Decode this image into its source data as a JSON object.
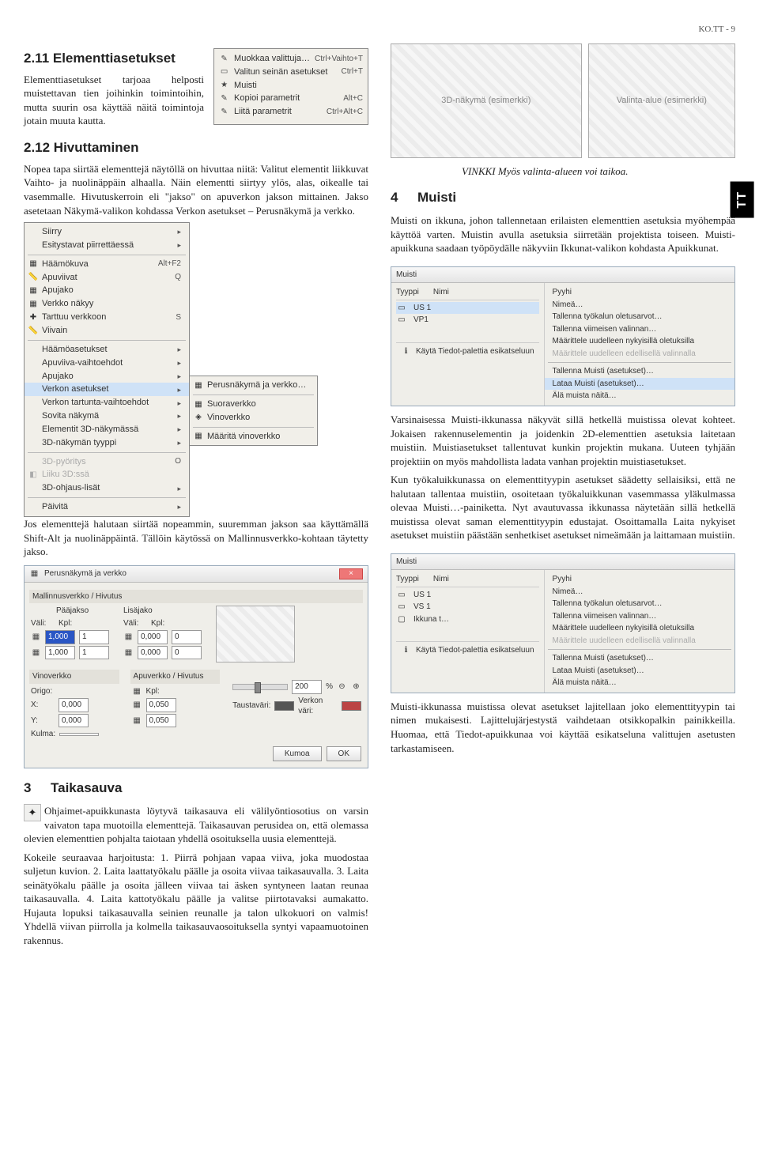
{
  "page_header": "KO.TT - 9",
  "side_tab": "TT",
  "sec211": {
    "title": "2.11  Elementtiasetukset",
    "p1": "Elementtiasetukset tarjoaa helposti muistettavan tien joihinkin toimintoihin, mutta suurin osa käyttää näitä toimintoja jotain muuta kautta."
  },
  "ctxmenu": {
    "items": [
      {
        "icon": "✎",
        "label": "Muokkaa valittuja…",
        "short": "Ctrl+Vaihto+T"
      },
      {
        "icon": "▭",
        "label": "Valitun seinän asetukset",
        "short": "Ctrl+T"
      },
      {
        "icon": "★",
        "label": "Muisti",
        "short": ""
      },
      {
        "icon": "✎",
        "label": "Kopioi parametrit",
        "short": "Alt+C"
      },
      {
        "icon": "✎",
        "label": "Liitä parametrit",
        "short": "Ctrl+Alt+C"
      }
    ]
  },
  "sec212": {
    "title": "2.12  Hivuttaminen",
    "p1": "Nopea tapa siirtää elementtejä näytöllä on hivuttaa niitä: Valitut elementit liikkuvat Vaihto- ja nuolinäppäin alhaalla. Näin elementti siirtyy ylös, alas, oikealle tai vasemmalle. Hivutuskerroin eli \"jakso\" on apuverkon jakson mittainen. Jakso asetetaan Näkymä-valikon kohdassa Verkon asetukset – Perusnäkymä ja verkko."
  },
  "viewmenu": {
    "left": [
      {
        "label": "Siirry",
        "arrow": true
      },
      {
        "label": "Esitystavat piirrettäessä",
        "arrow": true
      },
      {
        "sep": true
      },
      {
        "icon": "▦",
        "label": "Häämökuva",
        "short": "Alt+F2"
      },
      {
        "icon": "📏",
        "label": "Apuviivat",
        "short": "Q"
      },
      {
        "icon": "▦",
        "label": "Apujako"
      },
      {
        "icon": "▦",
        "label": "Verkko näkyy"
      },
      {
        "icon": "✚",
        "label": "Tarttuu verkkoon",
        "short": "S"
      },
      {
        "icon": "📏",
        "label": "Viivain"
      },
      {
        "sep": true
      },
      {
        "label": "Häämöasetukset",
        "arrow": true
      },
      {
        "label": "Apuviiva-vaihtoehdot",
        "arrow": true
      },
      {
        "label": "Apujako",
        "arrow": true
      },
      {
        "label": "Verkon asetukset",
        "arrow": true,
        "high": true
      },
      {
        "label": "Verkon tartunta-vaihtoehdot",
        "arrow": true
      },
      {
        "label": "Sovita näkymä",
        "arrow": true
      },
      {
        "label": "Elementit 3D-näkymässä",
        "arrow": true
      },
      {
        "label": "3D-näkymän tyyppi",
        "arrow": true
      },
      {
        "sep": true
      },
      {
        "label": "3D-pyöritys",
        "short": "O",
        "dis": true
      },
      {
        "icon": "◧",
        "label": "Liiku 3D:ssä",
        "dis": true
      },
      {
        "label": "3D-ohjaus-lisät",
        "arrow": true
      },
      {
        "sep": true
      },
      {
        "label": "Päivitä",
        "arrow": true
      }
    ],
    "sub": [
      {
        "icon": "▦",
        "label": "Perusnäkymä ja verkko…"
      },
      {
        "sep": true
      },
      {
        "icon": "▦",
        "label": "Suoraverkko"
      },
      {
        "icon": "◈",
        "label": "Vinoverkko"
      },
      {
        "sep": true
      },
      {
        "icon": "▦",
        "label": "Määritä vinoverkko"
      }
    ]
  },
  "p_after_menu": "Jos elementtejä halutaan siirtää nopeammin, suuremman jakson saa käyttämällä Shift-Alt ja nuolinäppäintä. Tällöin käytössä on Mallinnusverkko-kohtaan täytetty jakso.",
  "grid_dlg": {
    "title": "Perusnäkymä ja verkko",
    "sec1": "Mallinnusverkko / Hivutus",
    "paajakso": "Pääjakso",
    "lisajakso": "Lisäjako",
    "vali": "Väli:",
    "kpl": "Kpl:",
    "r1a": "1,000",
    "r1b": "1",
    "r1c": "0,000",
    "r1d": "0",
    "r2a": "1,000",
    "r2b": "1",
    "r2c": "0,000",
    "r2d": "0",
    "vino": "Vinoverkko",
    "origo": "Origo:",
    "x": "X:",
    "xv": "0,000",
    "y": "Y:",
    "yv": "0,000",
    "kulma": "Kulma:",
    "kulv": "",
    "apu": "Apuverkko / Hivutus",
    "apu_kpl": "Kpl:",
    "apu_v1": "0,050",
    "apu_v2": "0,050",
    "zoom": "200",
    "pct": "%",
    "tausta": "Taustaväri:",
    "verkko": "Verkon väri:",
    "kumoa": "Kumoa",
    "ok": "OK"
  },
  "sec3": {
    "title_num": "3",
    "title": "Taikasauva",
    "p1": "Ohjaimet-apuikkunasta löytyvä taikasauva eli välilyöntiosotius on varsin vaivaton tapa muotoilla elementtejä. Taikasauvan perusidea on, että olemassa olevien elementtien pohjalta taiotaan yhdellä osoituksella uusia elementtejä.",
    "p2": "Kokeile seuraavaa harjoitusta: 1. Piirrä pohjaan vapaa viiva, joka muodostaa suljetun kuvion. 2. Laita laattatyökalu päälle ja osoita viivaa taikasauvalla. 3. Laita seinätyökalu päälle ja osoita jälleen viivaa tai äsken syntyneen laatan reunaa taikasauvalla. 4. Laita kattotyökalu päälle ja valitse piirtotavaksi aumakatto. Hujauta lopuksi taikasauvalla seinien reunalle ja talon ulkokuori on valmis! Yhdellä viivan piirrolla ja kolmella taikasauvaosoituksella syntyi vapaamuotoinen rakennus."
  },
  "right_top": {
    "img1_label": "3D-näkymä (esimerkki)",
    "img2_label": "Valinta-alue (esimerkki)",
    "hint": "VINKKI Myös valinta-alueen voi taikoa."
  },
  "sec4": {
    "title_num": "4",
    "title": "Muisti",
    "p1": "Muisti on ikkuna, johon tallennetaan erilaisten elementtien asetuksia myöhempää käyttöä varten. Muistin avulla asetuksia siirretään projektista toiseen. Muisti-apuikkuna saadaan työpöydälle näkyviin Ikkunat-valikon kohdasta Apuikkunat."
  },
  "muisti1": {
    "title": "Muisti",
    "hdr1": "Tyyppi",
    "hdr2": "Nimi",
    "rows": [
      {
        "ico": "▭",
        "name": "US 1",
        "hi": true
      },
      {
        "ico": "▭",
        "name": "VP1"
      }
    ],
    "bottom_label": "Käytä Tiedot-palettia esikatseluun",
    "menu": [
      {
        "label": "Pyyhi"
      },
      {
        "label": "Nimeä…"
      },
      {
        "label": "Tallenna työkalun oletusarvot…"
      },
      {
        "label": "Tallenna viimeisen valinnan…"
      },
      {
        "label": "Määrittele uudelleen nykyisillä oletuksilla"
      },
      {
        "label": "Määrittele uudelleen edellisellä valinnalla",
        "dis": true
      },
      {
        "sep": true
      },
      {
        "label": "Tallenna Muisti (asetukset)…"
      },
      {
        "label": "Lataa Muisti (asetukset)…",
        "hi": true
      },
      {
        "label": "Älä muista näitä…"
      }
    ]
  },
  "sec4b": {
    "p2": "Varsinaisessa Muisti-ikkunassa näkyvät sillä hetkellä muistissa olevat kohteet. Jokaisen rakennuselementin ja joidenkin 2D-elementtien asetuksia laitetaan muistiin. Muistiasetukset tallentuvat kunkin projektin mukana. Uuteen tyhjään projektiin on myös mahdollista ladata vanhan projektin muistiasetukset.",
    "p3": "Kun työkaluikkunassa on elementtityypin asetukset säädetty sellaisiksi, että ne halutaan tallentaa muistiin, osoitetaan työkaluikkunan vasemmassa yläkulmassa olevaa Muisti…-painiketta. Nyt avautuvassa ikkunassa näytetään sillä hetkellä muistissa olevat saman elementtityypin edustajat. Osoittamalla Laita nykyiset asetukset muistiin päästään senhetkiset asetukset nimeämään ja laittamaan muistiin."
  },
  "muisti2": {
    "title": "Muisti",
    "hdr1": "Tyyppi",
    "hdr2": "Nimi",
    "rows": [
      {
        "ico": "▭",
        "name": "US 1"
      },
      {
        "ico": "▭",
        "name": "VS 1"
      },
      {
        "ico": "▢",
        "name": "Ikkuna t…"
      }
    ],
    "bottom_label": "Käytä Tiedot-palettia esikatseluun",
    "menu": [
      {
        "label": "Pyyhi"
      },
      {
        "label": "Nimeä…"
      },
      {
        "label": "Tallenna työkalun oletusarvot…"
      },
      {
        "label": "Tallenna viimeisen valinnan…"
      },
      {
        "label": "Määrittele uudelleen nykyisillä oletuksilla"
      },
      {
        "label": "Määrittele uudelleen edellisellä valinnalla",
        "dis": true
      },
      {
        "sep": true
      },
      {
        "label": "Tallenna Muisti (asetukset)…"
      },
      {
        "label": "Lataa Muisti (asetukset)…"
      },
      {
        "label": "Älä muista näitä…"
      }
    ]
  },
  "sec4c": {
    "p4": "Muisti-ikkunassa muistissa olevat asetukset lajitellaan joko elementtityypin tai nimen mukaisesti. Lajittelujärjestystä vaihdetaan otsikkopalkin painikkeilla. Huomaa, että Tiedot-apuikkunaa voi käyttää esikatseluna valittujen asetusten tarkastamiseen."
  }
}
